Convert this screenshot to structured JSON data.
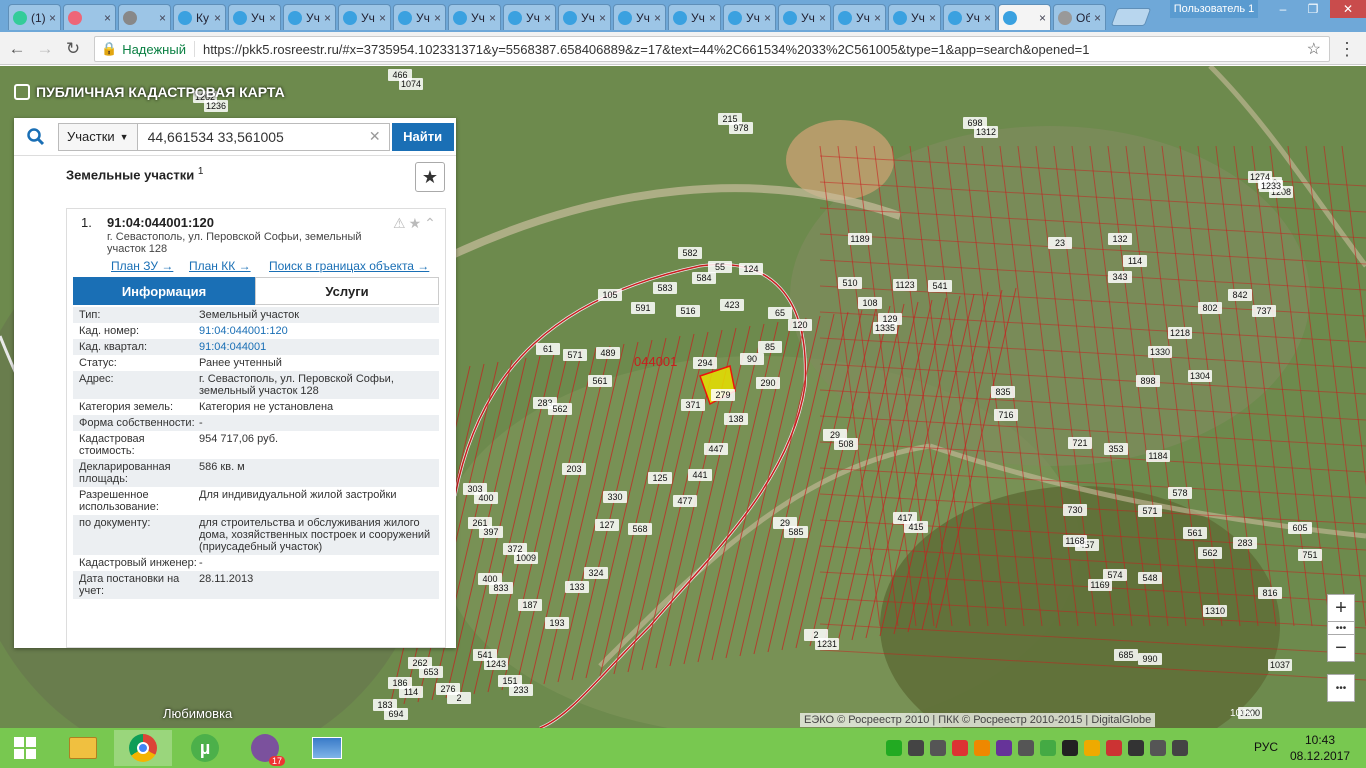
{
  "browser": {
    "tabs": [
      {
        "label": "(1)",
        "color": "#3c9"
      },
      {
        "label": "",
        "color": "#e67"
      },
      {
        "label": "",
        "color": "#888"
      },
      {
        "label": "Ку",
        "color": "#3aa1e0"
      },
      {
        "label": "Уч",
        "color": "#3aa1e0"
      },
      {
        "label": "Уч",
        "color": "#3aa1e0"
      },
      {
        "label": "Уч",
        "color": "#3aa1e0"
      },
      {
        "label": "Уч",
        "color": "#3aa1e0"
      },
      {
        "label": "Уч",
        "color": "#3aa1e0"
      },
      {
        "label": "Уч",
        "color": "#3aa1e0"
      },
      {
        "label": "Уч",
        "color": "#3aa1e0"
      },
      {
        "label": "Уч",
        "color": "#3aa1e0"
      },
      {
        "label": "Уч",
        "color": "#3aa1e0"
      },
      {
        "label": "Уч",
        "color": "#3aa1e0"
      },
      {
        "label": "Уч",
        "color": "#3aa1e0"
      },
      {
        "label": "Уч",
        "color": "#3aa1e0"
      },
      {
        "label": "Уч",
        "color": "#3aa1e0"
      },
      {
        "label": "Уч",
        "color": "#3aa1e0"
      },
      {
        "label": "",
        "color": "#3aa1e0",
        "active": true
      },
      {
        "label": "Об",
        "color": "#999"
      }
    ],
    "user": "Пользователь 1",
    "secure_label": "Надежный",
    "url": "https://pkk5.rosreestr.ru/#x=3735954.102331371&y=5568387.658406889&z=17&text=44%2C661534%2033%2C561005&type=1&app=search&opened=1"
  },
  "map": {
    "title": "ПУБЛИЧНАЯ КАДАСТРОВАЯ КАРТА",
    "quarter_label": "044001",
    "locality": "Любимовка",
    "copyright": "ЕЭКО © Росреестр 2010 | ПКК © Росреестр 2010-2015 | DigitalGlobe",
    "scale": "100м",
    "zoom_in": "+",
    "zoom_out": "−",
    "more": "•••"
  },
  "search": {
    "type": "Участки",
    "query": "44,661534 33,561005",
    "button": "Найти"
  },
  "results": {
    "title": "Земельные участки",
    "count": "1"
  },
  "card": {
    "index": "1.",
    "cad_number": "91:04:044001:120",
    "address": "г. Севастополь, ул. Перовской Софьи, земельный участок 128",
    "links": {
      "plan_zu": "План ЗУ →",
      "plan_kk": "План КК →",
      "search_bounds": "Поиск в границах объекта →"
    },
    "tab_info": "Информация",
    "tab_services": "Услуги",
    "rows": [
      {
        "k": "Тип:",
        "v": "Земельный участок"
      },
      {
        "k": "Кад. номер:",
        "v": "91:04:044001:120",
        "link": true
      },
      {
        "k": "Кад. квартал:",
        "v": "91:04:044001",
        "link": true
      },
      {
        "k": "Статус:",
        "v": "Ранее учтенный"
      },
      {
        "k": "Адрес:",
        "v": "г. Севастополь, ул. Перовской Софьи, земельный участок 128"
      },
      {
        "k": "Категория земель:",
        "v": "Категория не установлена"
      },
      {
        "k": "Форма собственности:",
        "v": "-"
      },
      {
        "k": "Кадастровая стоимость:",
        "v": "954 717,06 руб."
      },
      {
        "k": "Декларированная площадь:",
        "v": "586 кв. м"
      },
      {
        "k": "Разрешенное использование:",
        "v": "Для индивидуальной жилой застройки"
      },
      {
        "k": "по документу:",
        "v": "для строительства и обслуживания жилого дома, хозяйственных построек и сооружений (приусадебный участок)"
      },
      {
        "k": "Кадастровый инженер:",
        "v": "-"
      },
      {
        "k": "Дата постановки на учет:",
        "v": "28.11.2013"
      }
    ]
  },
  "parcels": [
    "466",
    "215",
    "1262",
    "219",
    "698",
    "1274",
    "29",
    "29",
    "2",
    "417",
    "303",
    "261",
    "372",
    "400",
    "183",
    "186",
    "262",
    "276",
    "541",
    "151",
    "187",
    "193",
    "133",
    "324",
    "203",
    "127",
    "330",
    "125",
    "568",
    "477",
    "441",
    "447",
    "371",
    "294",
    "279",
    "138",
    "290",
    "90",
    "85",
    "120",
    "65",
    "124",
    "55",
    "582",
    "584",
    "423",
    "516",
    "583",
    "591",
    "489",
    "571",
    "61",
    "283",
    "562",
    "561",
    "105",
    "510",
    "108",
    "129",
    "132",
    "114",
    "343",
    "457",
    "574",
    "548",
    "571",
    "578",
    "561",
    "562",
    "283",
    "605",
    "751",
    "816",
    "1037",
    "1200",
    "685",
    "990",
    "1169",
    "1168",
    "730",
    "716",
    "835",
    "721",
    "353",
    "1184",
    "1304",
    "1330",
    "1218",
    "802",
    "842",
    "737",
    "1189",
    "1123",
    "541",
    "23",
    "898",
    "1335",
    "1310",
    "1313",
    "1074",
    "978",
    "1236",
    "1208",
    "1312",
    "1233",
    "508",
    "585",
    "1231",
    "415",
    "400",
    "397",
    "1009",
    "833",
    "694",
    "114",
    "653",
    "2",
    "1243",
    "233"
  ],
  "taskbar": {
    "lang": "РУС",
    "time": "10:43",
    "date": "08.12.2017",
    "viber_badge": "17"
  }
}
